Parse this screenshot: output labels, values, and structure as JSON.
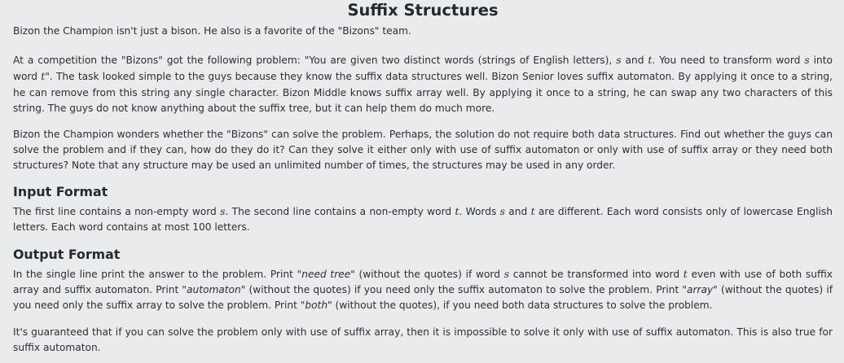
{
  "title": "Suffix Structures",
  "intro": "Bizon the Champion isn't just a bison. He also is a favorite of the \"Bizons\" team.",
  "problem": {
    "before_s": "At a competition the \"Bizons\" got the following problem: \"You are given two distinct words (strings of English letters), ",
    "var_s": "s",
    "and": " and ",
    "var_t": "t",
    "mid": ". You need to transform word ",
    "var_s2": "s",
    "into": " into word ",
    "var_t2": "t",
    "rest": "\". The task looked simple to the guys because they know the suffix data structures well. Bizon Senior loves suffix automaton. By applying it once to a string, he can remove from this string any single character. Bizon Middle knows suffix array well. By applying it once to a string, he can swap any two characters of this string. The guys do not know anything about the suffix tree, but it can help them do much more."
  },
  "wonder": "Bizon the Champion wonders whether the \"Bizons\" can solve the problem. Perhaps, the solution do not require both data structures. Find out whether the guys can solve the problem and if they can, how do they do it? Can they solve it either only with use of suffix automaton or only with use of suffix array or they need both structures? Note that any structure may be used an unlimited number of times, the structures may be used in any order.",
  "input_format": {
    "heading": "Input Format",
    "t1": "The first line contains a non-empty word ",
    "s": "s",
    "t2": ". The second line contains a non-empty word ",
    "t": "t",
    "t3": ". Words ",
    "s2": "s",
    "t4": " and ",
    "t_2": "t",
    "t5": " are different. Each word consists only of lowercase English letters. Each word contains at most 100 letters."
  },
  "output_format": {
    "heading": "Output Format",
    "t1": "In the single line print the answer to the problem. Print ",
    "need_tree": "\"need tree\"",
    "t2": " (without the quotes) if word ",
    "s": "s",
    "t3": " cannot be transformed into word ",
    "t": "t",
    "t4": " even with use of both suffix array and suffix automaton. Print ",
    "automaton": "\"automaton\"",
    "t5": " (without the quotes) if you need only the suffix automaton to solve the problem. Print ",
    "array": "\"array\"",
    "t6": " (without the quotes) if you need only the suffix array to solve the problem. Print ",
    "both": "\"both\"",
    "t7": " (without the quotes), if you need both data structures to solve the problem."
  },
  "guarantee": "It's guaranteed that if you can solve the problem only with use of suffix array, then it is impossible to solve it only with use of suffix automaton. This is also true for suffix automaton."
}
